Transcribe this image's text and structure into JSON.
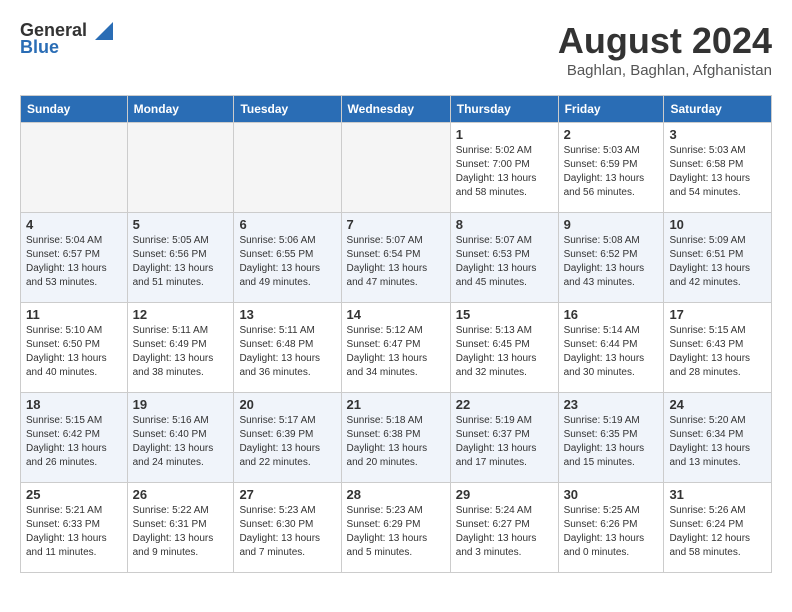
{
  "logo": {
    "general": "General",
    "blue": "Blue"
  },
  "header": {
    "month": "August 2024",
    "location": "Baghlan, Baghlan, Afghanistan"
  },
  "weekdays": [
    "Sunday",
    "Monday",
    "Tuesday",
    "Wednesday",
    "Thursday",
    "Friday",
    "Saturday"
  ],
  "weeks": [
    [
      {
        "day": "",
        "info": ""
      },
      {
        "day": "",
        "info": ""
      },
      {
        "day": "",
        "info": ""
      },
      {
        "day": "",
        "info": ""
      },
      {
        "day": "1",
        "info": "Sunrise: 5:02 AM\nSunset: 7:00 PM\nDaylight: 13 hours and 58 minutes."
      },
      {
        "day": "2",
        "info": "Sunrise: 5:03 AM\nSunset: 6:59 PM\nDaylight: 13 hours and 56 minutes."
      },
      {
        "day": "3",
        "info": "Sunrise: 5:03 AM\nSunset: 6:58 PM\nDaylight: 13 hours and 54 minutes."
      }
    ],
    [
      {
        "day": "4",
        "info": "Sunrise: 5:04 AM\nSunset: 6:57 PM\nDaylight: 13 hours and 53 minutes."
      },
      {
        "day": "5",
        "info": "Sunrise: 5:05 AM\nSunset: 6:56 PM\nDaylight: 13 hours and 51 minutes."
      },
      {
        "day": "6",
        "info": "Sunrise: 5:06 AM\nSunset: 6:55 PM\nDaylight: 13 hours and 49 minutes."
      },
      {
        "day": "7",
        "info": "Sunrise: 5:07 AM\nSunset: 6:54 PM\nDaylight: 13 hours and 47 minutes."
      },
      {
        "day": "8",
        "info": "Sunrise: 5:07 AM\nSunset: 6:53 PM\nDaylight: 13 hours and 45 minutes."
      },
      {
        "day": "9",
        "info": "Sunrise: 5:08 AM\nSunset: 6:52 PM\nDaylight: 13 hours and 43 minutes."
      },
      {
        "day": "10",
        "info": "Sunrise: 5:09 AM\nSunset: 6:51 PM\nDaylight: 13 hours and 42 minutes."
      }
    ],
    [
      {
        "day": "11",
        "info": "Sunrise: 5:10 AM\nSunset: 6:50 PM\nDaylight: 13 hours and 40 minutes."
      },
      {
        "day": "12",
        "info": "Sunrise: 5:11 AM\nSunset: 6:49 PM\nDaylight: 13 hours and 38 minutes."
      },
      {
        "day": "13",
        "info": "Sunrise: 5:11 AM\nSunset: 6:48 PM\nDaylight: 13 hours and 36 minutes."
      },
      {
        "day": "14",
        "info": "Sunrise: 5:12 AM\nSunset: 6:47 PM\nDaylight: 13 hours and 34 minutes."
      },
      {
        "day": "15",
        "info": "Sunrise: 5:13 AM\nSunset: 6:45 PM\nDaylight: 13 hours and 32 minutes."
      },
      {
        "day": "16",
        "info": "Sunrise: 5:14 AM\nSunset: 6:44 PM\nDaylight: 13 hours and 30 minutes."
      },
      {
        "day": "17",
        "info": "Sunrise: 5:15 AM\nSunset: 6:43 PM\nDaylight: 13 hours and 28 minutes."
      }
    ],
    [
      {
        "day": "18",
        "info": "Sunrise: 5:15 AM\nSunset: 6:42 PM\nDaylight: 13 hours and 26 minutes."
      },
      {
        "day": "19",
        "info": "Sunrise: 5:16 AM\nSunset: 6:40 PM\nDaylight: 13 hours and 24 minutes."
      },
      {
        "day": "20",
        "info": "Sunrise: 5:17 AM\nSunset: 6:39 PM\nDaylight: 13 hours and 22 minutes."
      },
      {
        "day": "21",
        "info": "Sunrise: 5:18 AM\nSunset: 6:38 PM\nDaylight: 13 hours and 20 minutes."
      },
      {
        "day": "22",
        "info": "Sunrise: 5:19 AM\nSunset: 6:37 PM\nDaylight: 13 hours and 17 minutes."
      },
      {
        "day": "23",
        "info": "Sunrise: 5:19 AM\nSunset: 6:35 PM\nDaylight: 13 hours and 15 minutes."
      },
      {
        "day": "24",
        "info": "Sunrise: 5:20 AM\nSunset: 6:34 PM\nDaylight: 13 hours and 13 minutes."
      }
    ],
    [
      {
        "day": "25",
        "info": "Sunrise: 5:21 AM\nSunset: 6:33 PM\nDaylight: 13 hours and 11 minutes."
      },
      {
        "day": "26",
        "info": "Sunrise: 5:22 AM\nSunset: 6:31 PM\nDaylight: 13 hours and 9 minutes."
      },
      {
        "day": "27",
        "info": "Sunrise: 5:23 AM\nSunset: 6:30 PM\nDaylight: 13 hours and 7 minutes."
      },
      {
        "day": "28",
        "info": "Sunrise: 5:23 AM\nSunset: 6:29 PM\nDaylight: 13 hours and 5 minutes."
      },
      {
        "day": "29",
        "info": "Sunrise: 5:24 AM\nSunset: 6:27 PM\nDaylight: 13 hours and 3 minutes."
      },
      {
        "day": "30",
        "info": "Sunrise: 5:25 AM\nSunset: 6:26 PM\nDaylight: 13 hours and 0 minutes."
      },
      {
        "day": "31",
        "info": "Sunrise: 5:26 AM\nSunset: 6:24 PM\nDaylight: 12 hours and 58 minutes."
      }
    ]
  ]
}
